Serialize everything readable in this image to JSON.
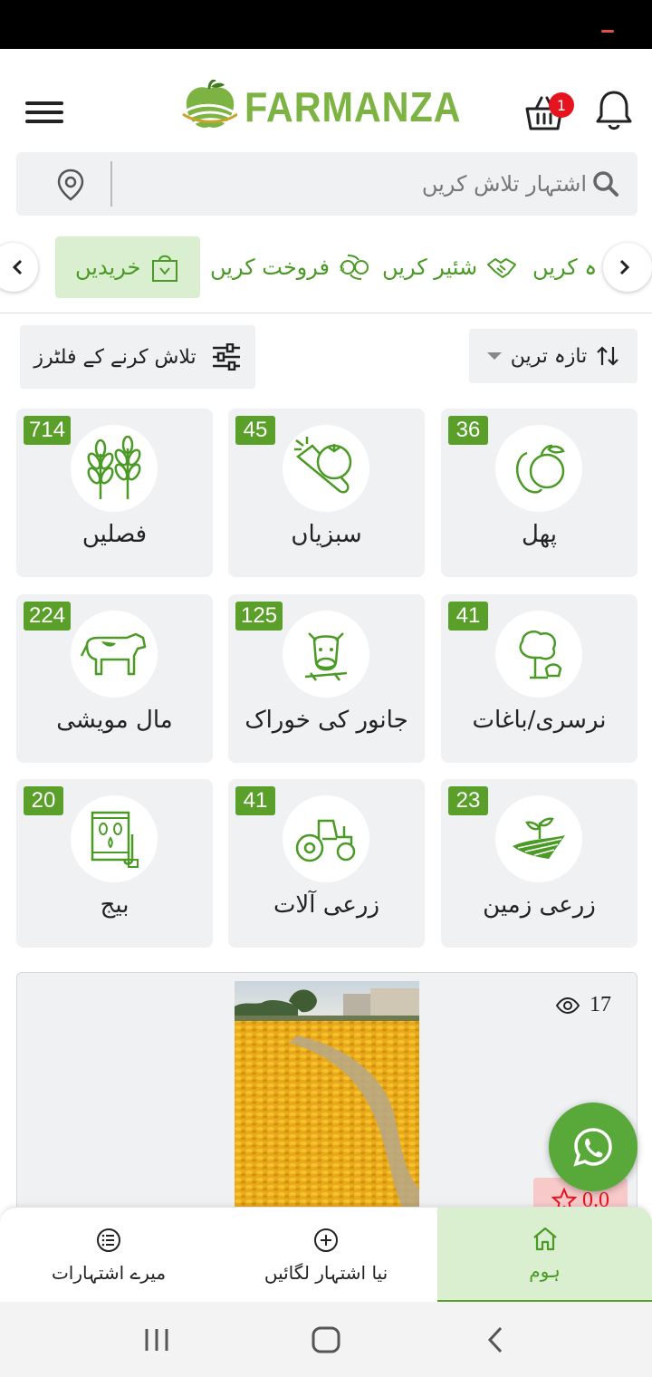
{
  "app": {
    "name": "FARMANZA",
    "cart_count": "1"
  },
  "search": {
    "placeholder": "اشتہار تلاش کریں"
  },
  "tabs": [
    {
      "label": "خریدیں",
      "icon": "shopping-bag-icon",
      "active": true
    },
    {
      "label": "فروخت کریں",
      "icon": "money-exchange-icon",
      "active": false
    },
    {
      "label": "شئیر کریں",
      "icon": "handshake-icon",
      "active": false
    },
    {
      "label": "ہ کریں",
      "icon": "",
      "active": false
    }
  ],
  "filters": {
    "filter_label": "تلاش کرنے کے فلٹرز",
    "sort_label": "تازہ ترین"
  },
  "categories": [
    {
      "label": "پھل",
      "count": "36",
      "icon": "fruit-icon"
    },
    {
      "label": "سبزیاں",
      "count": "45",
      "icon": "vegetables-icon"
    },
    {
      "label": "فصلیں",
      "count": "714",
      "icon": "wheat-icon"
    },
    {
      "label": "نرسری/باغات",
      "count": "41",
      "icon": "nursery-tree-icon"
    },
    {
      "label": "جانور کی خوراک",
      "count": "125",
      "icon": "animal-feed-icon"
    },
    {
      "label": "مال مویشی",
      "count": "224",
      "icon": "cow-icon"
    },
    {
      "label": "زرعی زمین",
      "count": "23",
      "icon": "farmland-icon"
    },
    {
      "label": "زرعی آلات",
      "count": "41",
      "icon": "tractor-icon"
    },
    {
      "label": "بیج",
      "count": "20",
      "icon": "seed-bag-icon"
    }
  ],
  "listing": {
    "views": "17",
    "rating": "0.0"
  },
  "bottom_nav": [
    {
      "label": "ہوم",
      "icon": "home-icon",
      "active": true
    },
    {
      "label": "نیا اشتہار لگائیں",
      "icon": "plus-circle-icon",
      "active": false
    },
    {
      "label": "میرے اشتہارات",
      "icon": "list-icon",
      "active": false
    }
  ],
  "colors": {
    "brand_green": "#7cb342",
    "badge_green": "#5a9f2a",
    "active_tab_bg": "#d9efcf",
    "alert_red": "#e5141f"
  }
}
